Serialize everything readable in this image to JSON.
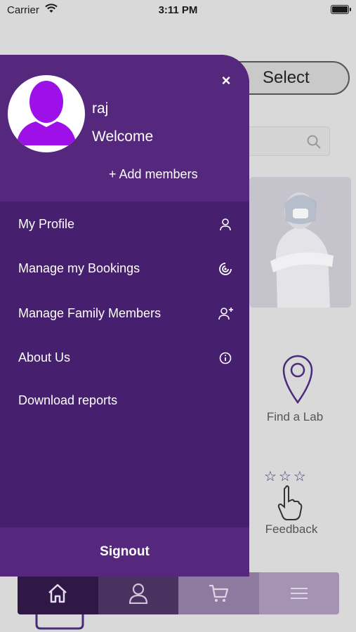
{
  "status_bar": {
    "carrier": "Carrier",
    "time": "3:11 PM"
  },
  "background": {
    "select_label": "Select",
    "find_lab_label": "Find a Lab",
    "feedback_label": "Feedback",
    "rating_stars": "☆☆☆"
  },
  "drawer": {
    "close_label": "×",
    "user_name": "raj",
    "welcome": "Welcome",
    "add_members": "+ Add members",
    "menu": [
      {
        "label": "My Profile",
        "icon": "person-icon"
      },
      {
        "label": "Manage my Bookings",
        "icon": "bookings-icon"
      },
      {
        "label": "Manage Family Members",
        "icon": "add-person-icon"
      },
      {
        "label": "About Us",
        "icon": "info-icon"
      },
      {
        "label": "Download reports",
        "icon": ""
      }
    ],
    "signout": "Signout"
  },
  "tabbar": {
    "tabs": [
      {
        "name": "home",
        "icon": "home-icon",
        "active": true
      },
      {
        "name": "profile",
        "icon": "person-icon",
        "active": false
      },
      {
        "name": "cart",
        "icon": "cart-icon",
        "active": false
      },
      {
        "name": "menu",
        "icon": "hamburger-icon",
        "active": false
      }
    ]
  },
  "colors": {
    "drawer": "#461f6e",
    "drawer_header": "#55287e",
    "avatar_silhouette": "#9d10e8",
    "overlay_background": "#d9d9d9"
  }
}
